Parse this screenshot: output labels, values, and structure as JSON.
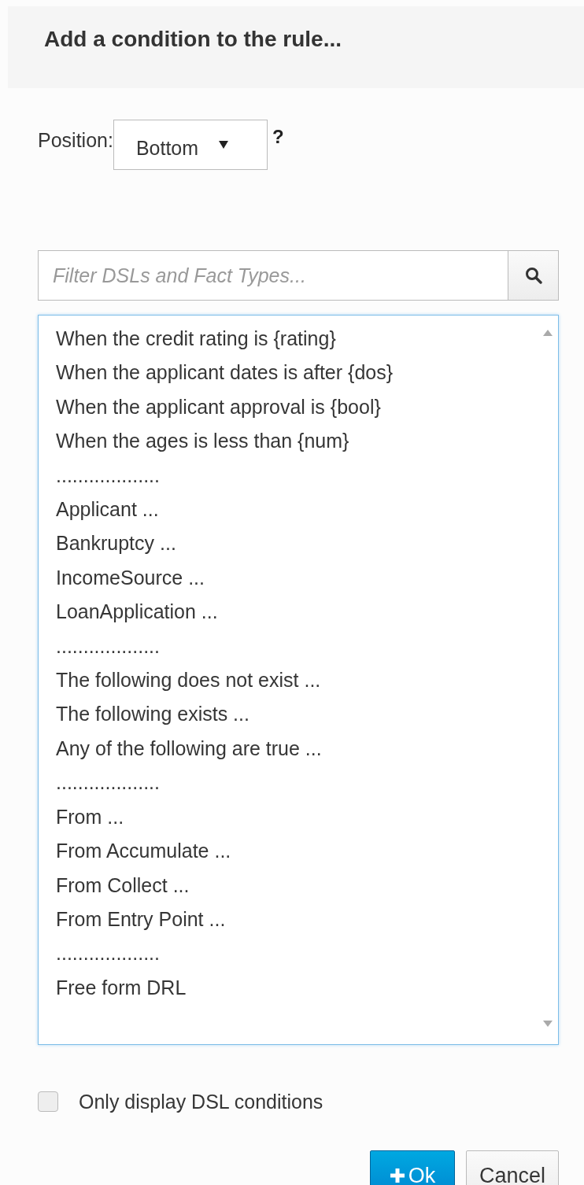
{
  "dialog": {
    "title": "Add a condition to the rule..."
  },
  "position": {
    "label": "Position:",
    "value": "Bottom",
    "help": "?"
  },
  "filter": {
    "placeholder": "Filter DSLs and Fact Types..."
  },
  "options": [
    "When the credit rating is {rating}",
    "When the applicant dates is after {dos}",
    "When the applicant approval is {bool}",
    "When the ages is less than {num}",
    "...................",
    "Applicant ...",
    "Bankruptcy ...",
    "IncomeSource ...",
    "LoanApplication ...",
    "...................",
    "The following does not exist ...",
    "The following exists ...",
    "Any of the following are true ...",
    "...................",
    "From ...",
    "From Accumulate ...",
    "From Collect ...",
    "From Entry Point ...",
    "...................",
    "Free form DRL"
  ],
  "dsl_only": {
    "label": "Only display DSL conditions",
    "checked": false
  },
  "buttons": [
    {
      "label": "Ok",
      "kind": "primary"
    },
    {
      "label": "Cancel",
      "kind": "default"
    }
  ]
}
